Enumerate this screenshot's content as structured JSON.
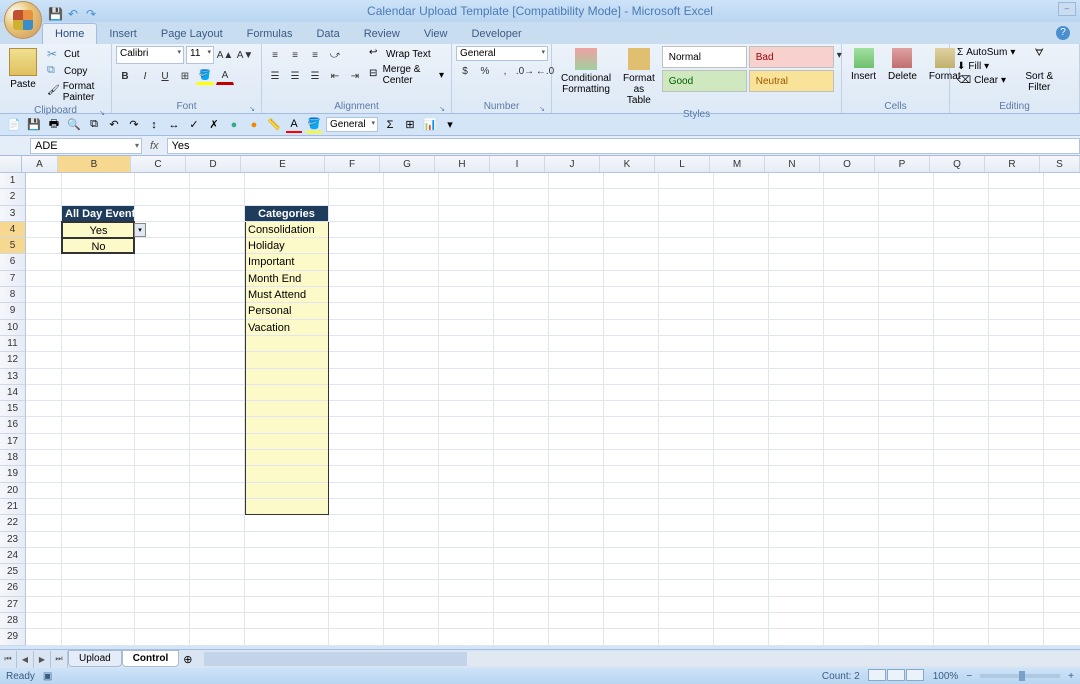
{
  "title": "Calendar Upload Template  [Compatibility Mode] - Microsoft Excel",
  "tabs": [
    "Home",
    "Insert",
    "Page Layout",
    "Formulas",
    "Data",
    "Review",
    "View",
    "Developer"
  ],
  "active_tab": "Home",
  "ribbon": {
    "clipboard": {
      "paste": "Paste",
      "cut": "Cut",
      "copy": "Copy",
      "painter": "Format Painter",
      "label": "Clipboard"
    },
    "font": {
      "name": "Calibri",
      "size": "11",
      "label": "Font"
    },
    "alignment": {
      "wrap": "Wrap Text",
      "merge": "Merge & Center",
      "label": "Alignment"
    },
    "number": {
      "format": "General",
      "label": "Number"
    },
    "styles": {
      "conditional": "Conditional\nFormatting",
      "table": "Format as\nTable",
      "normal": "Normal",
      "bad": "Bad",
      "good": "Good",
      "neutral": "Neutral",
      "label": "Styles"
    },
    "cells": {
      "insert": "Insert",
      "delete": "Delete",
      "format": "Format",
      "label": "Cells"
    },
    "editing": {
      "autosum": "AutoSum",
      "fill": "Fill",
      "clear": "Clear",
      "sort": "Sort &\nFilter",
      "label": "Editing"
    }
  },
  "qat2_format": "General",
  "name_box": "ADE",
  "formula": "Yes",
  "columns": [
    "A",
    "B",
    "C",
    "D",
    "E",
    "F",
    "G",
    "H",
    "I",
    "J",
    "K",
    "L",
    "M",
    "N",
    "O",
    "P",
    "Q",
    "R",
    "S"
  ],
  "rows": 29,
  "selected_col": "B",
  "selected_rows": [
    4,
    5
  ],
  "cell_data": {
    "b3_header": "All Day Event",
    "b4": "Yes",
    "b5": "No",
    "e3_header": "Categories",
    "categories": [
      "Consolidation",
      "Holiday",
      "Important",
      "Month End",
      "Must Attend",
      "Personal",
      "Vacation"
    ]
  },
  "sheet_tabs": [
    "Upload",
    "Control"
  ],
  "active_sheet": "Control",
  "status": {
    "ready": "Ready",
    "count": "Count: 2",
    "zoom": "100%"
  }
}
